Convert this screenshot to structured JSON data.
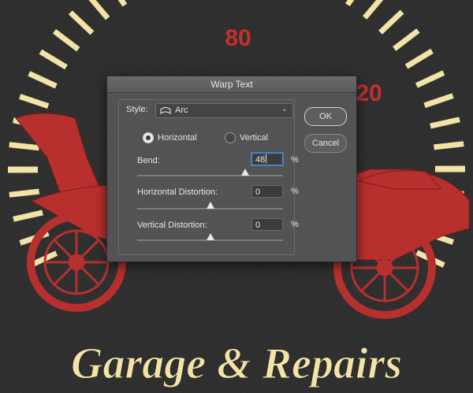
{
  "artwork": {
    "speedometer_labels": [
      "80",
      "20"
    ],
    "headline": "Garage & Repairs",
    "colors": {
      "background": "#1f1f1f",
      "gauge": "#f2e3a6",
      "accent_red": "#c3302f"
    }
  },
  "dialog": {
    "title": "Warp Text",
    "style_label": "Style:",
    "style_value": "Arc",
    "style_icon": "arc-warp-icon",
    "orientation": {
      "horizontal_label": "Horizontal",
      "vertical_label": "Vertical",
      "selected": "horizontal"
    },
    "bend": {
      "label": "Bend:",
      "value": "48",
      "unit": "%",
      "slider_percent": 48
    },
    "horizontal_distortion": {
      "label": "Horizontal Distortion:",
      "value": "0",
      "unit": "%",
      "slider_percent": 0
    },
    "vertical_distortion": {
      "label": "Vertical Distortion:",
      "value": "0",
      "unit": "%",
      "slider_percent": 0
    },
    "ok_label": "OK",
    "cancel_label": "Cancel"
  }
}
